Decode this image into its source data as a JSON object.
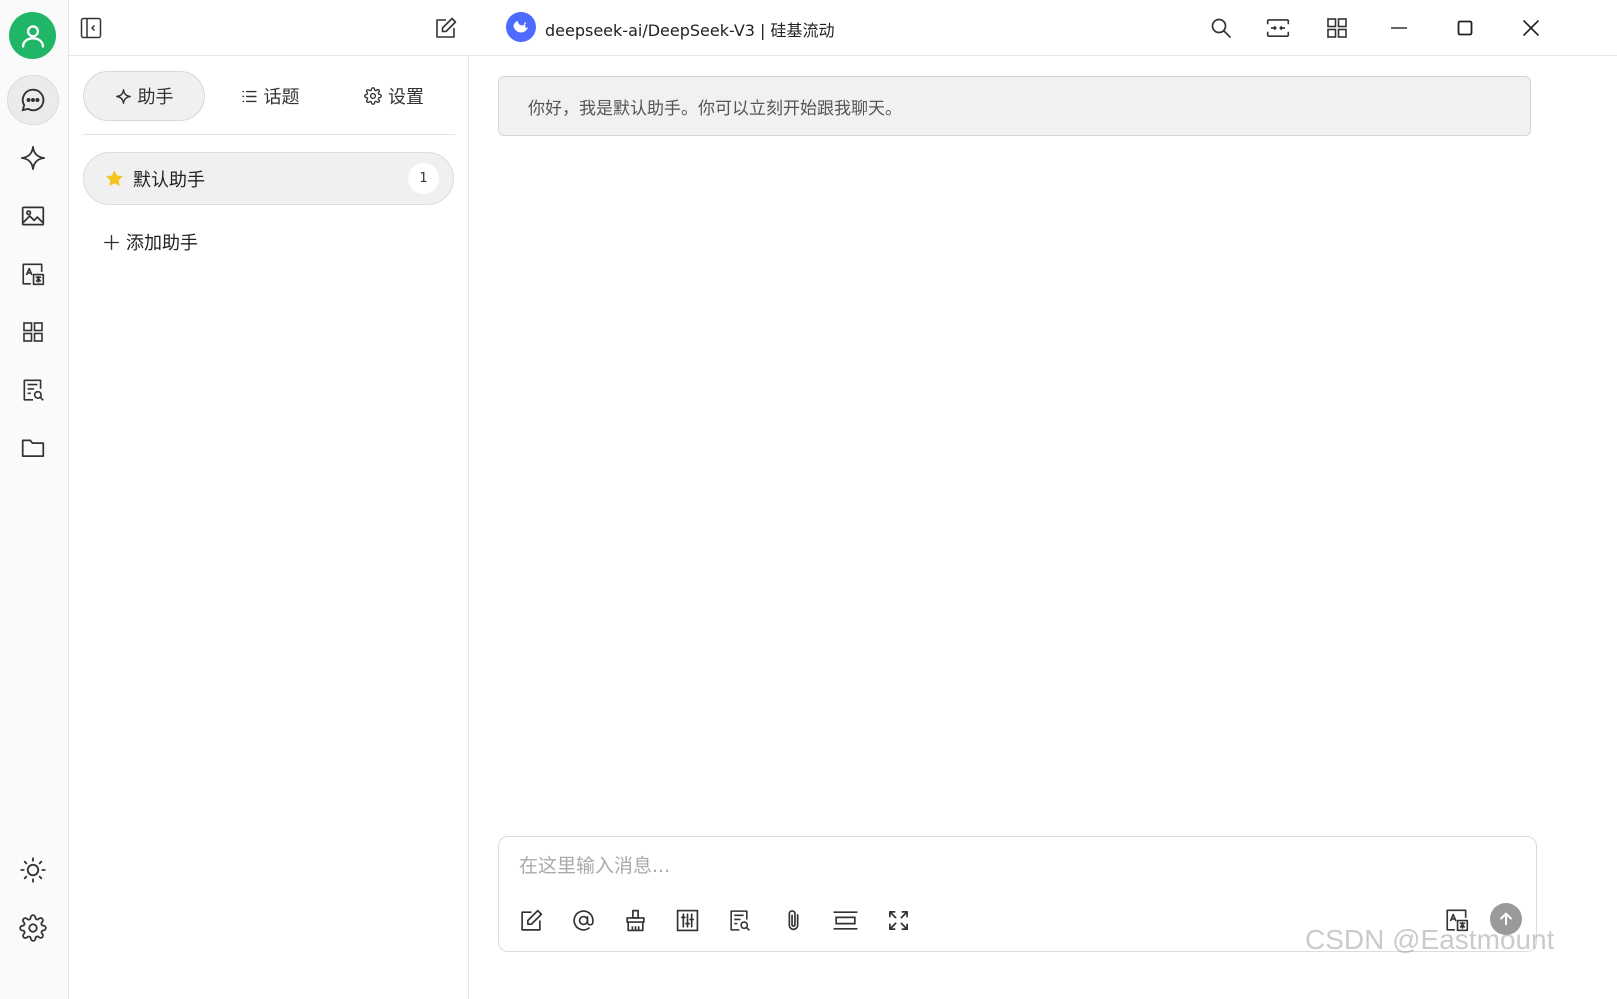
{
  "titlebar": {
    "model_title": "deepseek-ai/DeepSeek-V3 | 硅基流动",
    "icons": [
      "sidebar-toggle-icon",
      "new-topic-icon",
      "search-icon",
      "narrow-mode-icon",
      "minapp-grid-icon",
      "minimize-icon",
      "maximize-icon",
      "close-icon"
    ]
  },
  "rail": {
    "items": [
      "chat-icon",
      "sparkle-icon",
      "image-icon",
      "translate-icon",
      "apps-grid-icon",
      "knowledge-icon",
      "folder-icon"
    ],
    "bottom": [
      "theme-sun-icon",
      "settings-gear-icon"
    ]
  },
  "panel": {
    "tabs": [
      {
        "label": "助手",
        "icon": "sparkle-icon"
      },
      {
        "label": "话题",
        "icon": "list-icon"
      },
      {
        "label": "设置",
        "icon": "gear-icon"
      }
    ],
    "assistant": {
      "name": "默认助手",
      "count": "1",
      "icon": "star-icon"
    },
    "add_label": "添加助手"
  },
  "chat": {
    "greeting": "你好，我是默认助手。你可以立刻开始跟我聊天。",
    "input_placeholder": "在这里输入消息...",
    "tools": [
      "new-topic-icon",
      "mention-icon",
      "clear-broom-icon",
      "settings-sliders-icon",
      "knowledge-search-icon",
      "attachment-icon",
      "context-divider-icon",
      "expand-icon"
    ]
  },
  "watermark": "CSDN @Eastmount",
  "colors": {
    "avatar": "#1fb668",
    "model_badge": "#4d6bfe",
    "star": "#f6c31a"
  }
}
